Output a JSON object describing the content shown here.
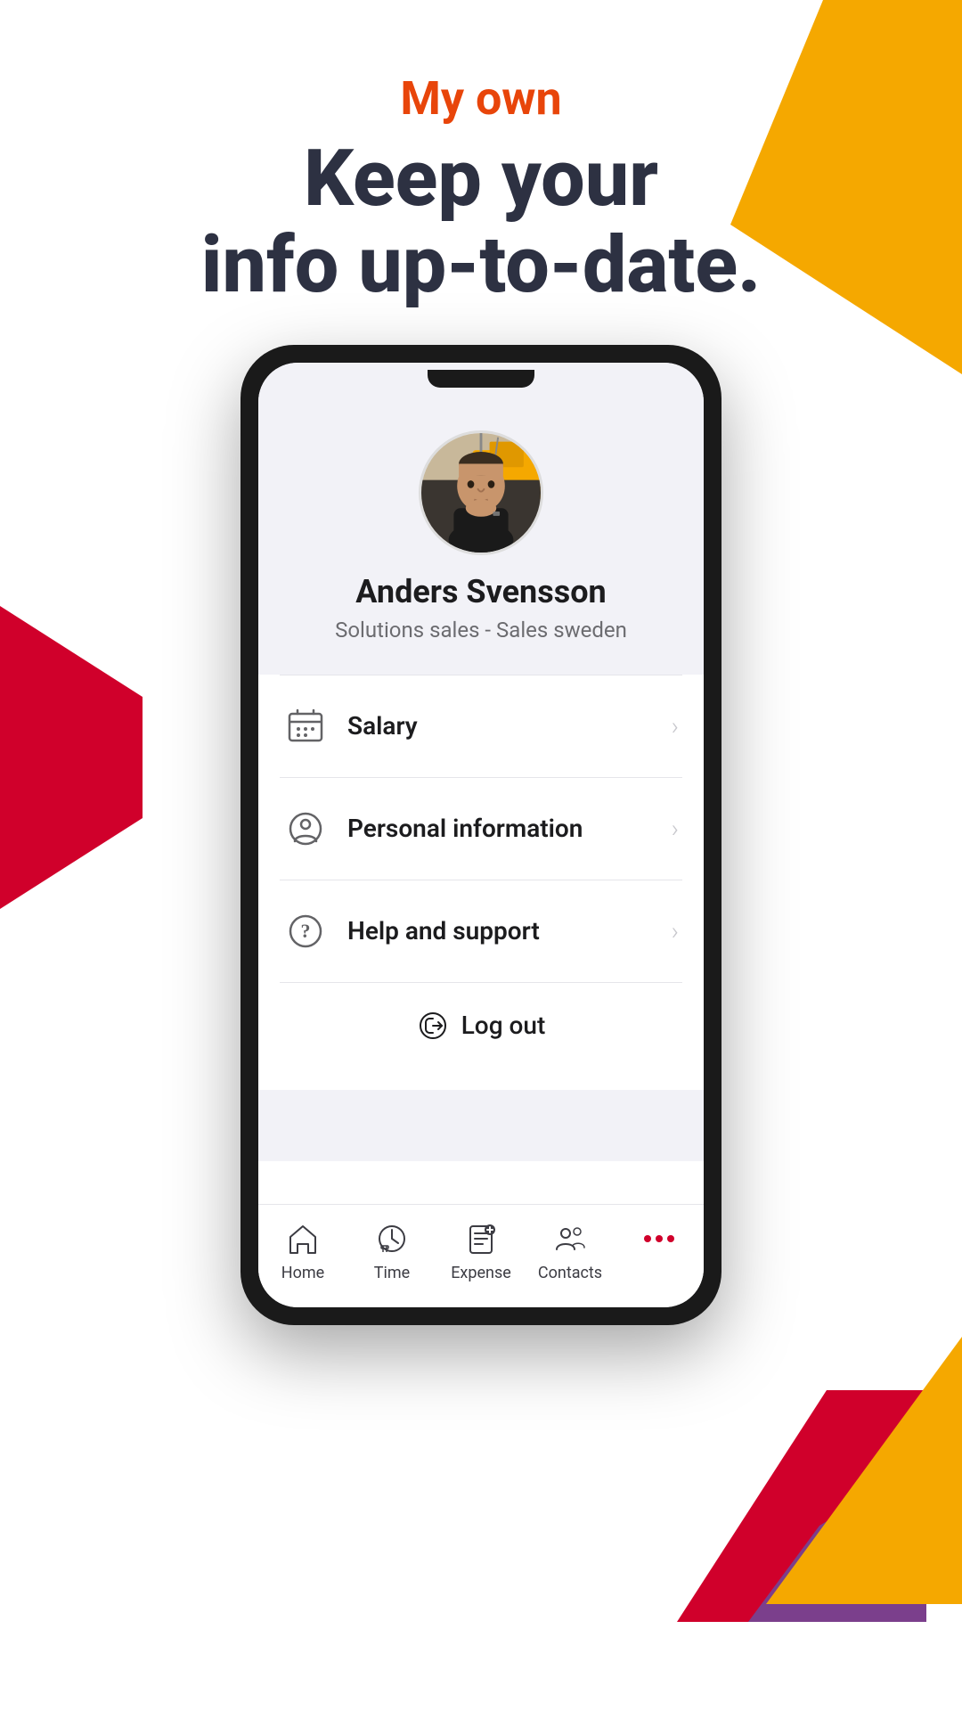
{
  "header": {
    "subtitle": "My own",
    "title": "Keep your\ninfo up-to-date."
  },
  "profile": {
    "name": "Anders Svensson",
    "role": "Solutions sales - Sales sweden"
  },
  "menu": {
    "items": [
      {
        "id": "salary",
        "label": "Salary",
        "icon": "calendar-salary"
      },
      {
        "id": "personal-information",
        "label": "Personal information",
        "icon": "person-circle"
      },
      {
        "id": "help-support",
        "label": "Help and support",
        "icon": "question-circle"
      }
    ],
    "logout_label": "Log out"
  },
  "bottom_nav": {
    "items": [
      {
        "id": "home",
        "label": "Home"
      },
      {
        "id": "time",
        "label": "Time"
      },
      {
        "id": "expense",
        "label": "Expense"
      },
      {
        "id": "contacts",
        "label": "Contacts"
      },
      {
        "id": "more",
        "label": ""
      }
    ]
  },
  "colors": {
    "accent_orange": "#E8450A",
    "brand_yellow": "#F5A800",
    "brand_red": "#D0002B",
    "brand_purple": "#7B3F8C",
    "text_dark": "#2d3142",
    "text_muted": "#6c6c70",
    "icon_gray": "#636366"
  }
}
